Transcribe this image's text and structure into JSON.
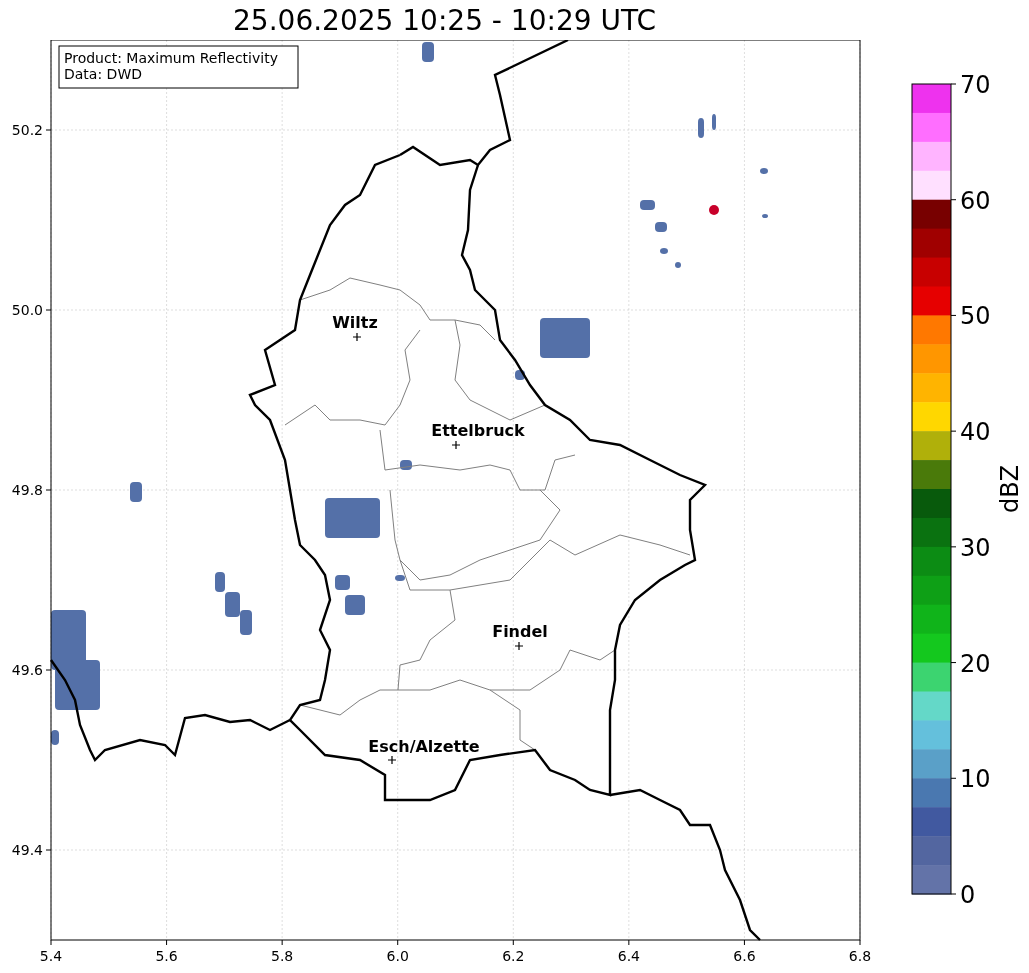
{
  "title": "25.06.2025 10:25 - 10:29 UTC",
  "info_box": [
    "Product: Maximum Reflectivity",
    "Data: DWD"
  ],
  "places": [
    {
      "name": "Wiltz"
    },
    {
      "name": "Ettelbruck"
    },
    {
      "name": "Findel"
    },
    {
      "name": "Esch/Alzette"
    }
  ],
  "x_ticks": [
    "5.4",
    "5.6",
    "5.8",
    "6.0",
    "6.2",
    "6.4",
    "6.6",
    "6.8"
  ],
  "y_ticks": [
    "50.2",
    "50.0",
    "49.8",
    "49.6",
    "49.4"
  ],
  "colorbar": {
    "label": "dBZ",
    "ticks": [
      "70",
      "60",
      "50",
      "40",
      "30",
      "20",
      "10",
      "0"
    ],
    "bands": [
      {
        "color": "#ee32ee"
      },
      {
        "color": "#ff6eff"
      },
      {
        "color": "#ffb4ff"
      },
      {
        "color": "#ffe0ff"
      },
      {
        "color": "#780000"
      },
      {
        "color": "#a00000"
      },
      {
        "color": "#c80000"
      },
      {
        "color": "#e60000"
      },
      {
        "color": "#ff7800"
      },
      {
        "color": "#ff9600"
      },
      {
        "color": "#ffb400"
      },
      {
        "color": "#ffd700"
      },
      {
        "color": "#b0b00a"
      },
      {
        "color": "#4a7a0a"
      },
      {
        "color": "#085a0c"
      },
      {
        "color": "#0a7210"
      },
      {
        "color": "#0c8c14"
      },
      {
        "color": "#0ea016"
      },
      {
        "color": "#10b41a"
      },
      {
        "color": "#14c81e"
      },
      {
        "color": "#3cd470"
      },
      {
        "color": "#64d8c8"
      },
      {
        "color": "#64c0dc"
      },
      {
        "color": "#5aa0c8"
      },
      {
        "color": "#4a78b0"
      },
      {
        "color": "#4159a0"
      },
      {
        "color": "#5366a0"
      },
      {
        "color": "#6373a8"
      }
    ]
  }
}
